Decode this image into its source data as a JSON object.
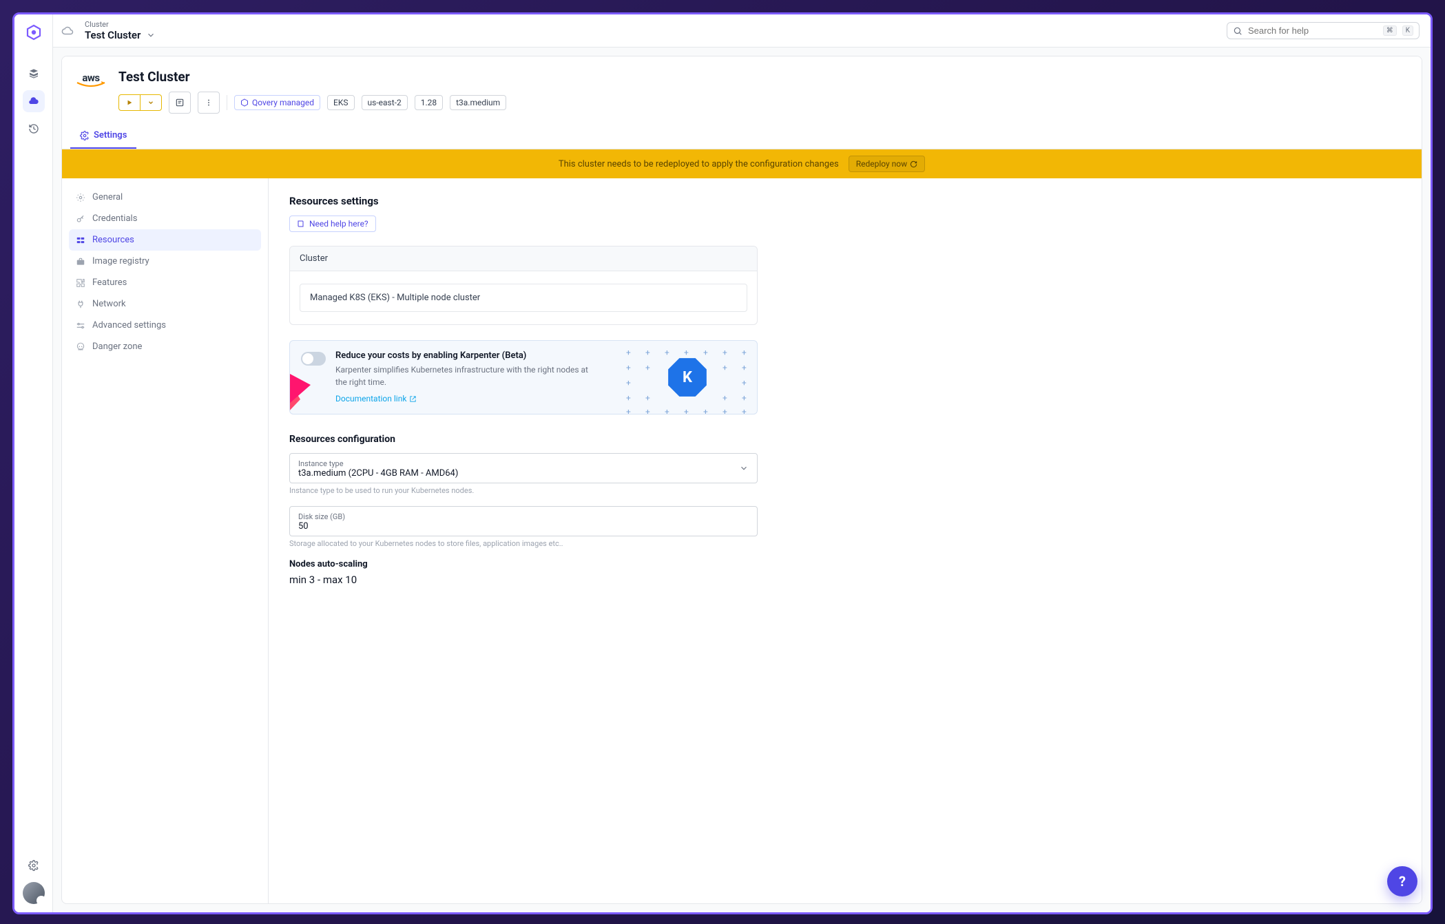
{
  "breadcrumb": {
    "label": "Cluster",
    "value": "Test Cluster"
  },
  "search": {
    "placeholder": "Search for help",
    "kbd1": "⌘",
    "kbd2": "K"
  },
  "cluster": {
    "title": "Test Cluster",
    "tags": {
      "managed": "Qovery managed",
      "eks": "EKS",
      "region": "us-east-2",
      "version": "1.28",
      "instance": "t3a.medium"
    }
  },
  "tabs": {
    "settings": "Settings"
  },
  "banner": {
    "text": "This cluster needs to be redeployed to apply the configuration changes",
    "action": "Redeploy now"
  },
  "side": {
    "general": "General",
    "credentials": "Credentials",
    "resources": "Resources",
    "image_registry": "Image registry",
    "features": "Features",
    "network": "Network",
    "advanced": "Advanced settings",
    "danger": "Danger zone"
  },
  "panel": {
    "title": "Resources settings",
    "help": "Need help here?",
    "cluster_card": {
      "head": "Cluster",
      "value": "Managed K8S (EKS) - Multiple node cluster"
    },
    "karpenter": {
      "title": "Reduce your costs by enabling Karpenter (Beta)",
      "desc": "Karpenter simplifies Kubernetes infrastructure with the right nodes at the right time.",
      "link": "Documentation link",
      "badge": "K"
    },
    "resconf": {
      "title": "Resources configuration",
      "instance_label": "Instance type",
      "instance_value": "t3a.medium (2CPU - 4GB RAM - AMD64)",
      "instance_hint": "Instance type to be used to run your Kubernetes nodes.",
      "disk_label": "Disk size (GB)",
      "disk_value": "50",
      "disk_hint": "Storage allocated to your Kubernetes nodes to store files, application images etc.."
    },
    "autoscale": {
      "title": "Nodes auto-scaling",
      "value": "min 3 - max 10"
    }
  },
  "fab": "?"
}
